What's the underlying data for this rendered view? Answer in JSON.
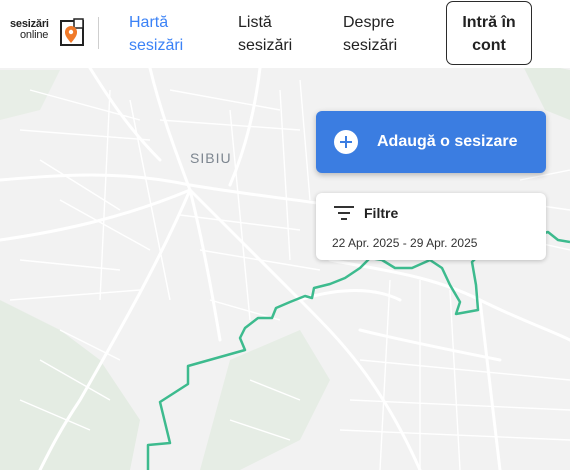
{
  "logo": {
    "line1": "sesizări",
    "line2": "online"
  },
  "nav": [
    {
      "line1": "Hartă",
      "line2": "sesizări",
      "active": true
    },
    {
      "line1": "Listă",
      "line2": "sesizări",
      "active": false
    },
    {
      "line1": "Despre",
      "line2": "sesizări",
      "active": false
    }
  ],
  "login": {
    "line1": "Intră în",
    "line2": "cont"
  },
  "map": {
    "city_label": "SIBIU",
    "boundary_color": "#3dbb8e",
    "accent_color": "#3b7de1"
  },
  "actions": {
    "add_label": "Adaugă o sesizare"
  },
  "filter": {
    "title": "Filtre",
    "date_range": "22 Apr. 2025 - 29 Apr. 2025"
  }
}
